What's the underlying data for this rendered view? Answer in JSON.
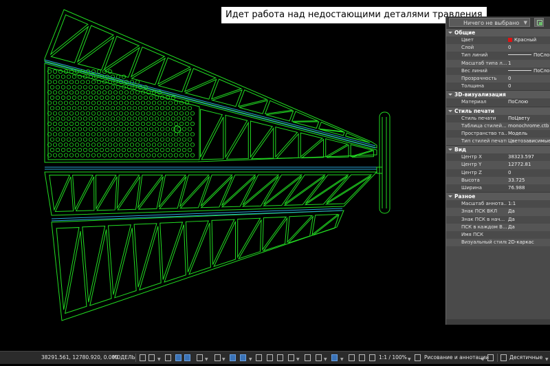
{
  "caption": "Идет работа над недостающими деталями травления",
  "palette": {
    "selection": "Ничего не выбрано",
    "sections": [
      {
        "title": "Общие",
        "rows": [
          {
            "key": "Цвет",
            "value": "Красный",
            "swatch": "#e11111"
          },
          {
            "key": "Слой",
            "value": "0"
          },
          {
            "key": "Тип линий",
            "value": "ПоСлою",
            "line": true
          },
          {
            "key": "Масштаб типа л...",
            "value": "1"
          },
          {
            "key": "Вес линий",
            "value": "ПоСлою",
            "line": true
          },
          {
            "key": "Прозрачность",
            "value": "0"
          },
          {
            "key": "Толщина",
            "value": "0"
          }
        ]
      },
      {
        "title": "3D-визуализация",
        "rows": [
          {
            "key": "Материал",
            "value": "ПоСлою"
          }
        ]
      },
      {
        "title": "Стиль печати",
        "rows": [
          {
            "key": "Стиль печати",
            "value": "ПоЦвету"
          },
          {
            "key": "Таблица стилей...",
            "value": "monochrome.ctb"
          },
          {
            "key": "Пространство та...",
            "value": "Модель"
          },
          {
            "key": "Тип стилей печати",
            "value": "Цветозависимые"
          }
        ]
      },
      {
        "title": "Вид",
        "rows": [
          {
            "key": "Центр X",
            "value": "38323.597"
          },
          {
            "key": "Центр Y",
            "value": "12772.81"
          },
          {
            "key": "Центр Z",
            "value": "0"
          },
          {
            "key": "Высота",
            "value": "33.725"
          },
          {
            "key": "Ширина",
            "value": "76.988"
          }
        ]
      },
      {
        "title": "Разное",
        "rows": [
          {
            "key": "Масштаб аннота...",
            "value": "1:1"
          },
          {
            "key": "Знак ПСК ВКЛ",
            "value": "Да"
          },
          {
            "key": "Знак ПСК в нач...",
            "value": "Да"
          },
          {
            "key": "ПСК в каждом В...",
            "value": "Да"
          },
          {
            "key": "Имя ПСК",
            "value": ""
          },
          {
            "key": "Визуальный стиль",
            "value": "2D-каркас"
          }
        ]
      }
    ]
  },
  "status": {
    "coords": "38291.561, 12780.920, 0.000",
    "model": "МОДЕЛЬ",
    "scale": "1:1 / 100%",
    "workspace": "Рисование и аннотации",
    "units": "Десятичные"
  },
  "colors": {
    "outline": "#22dd22",
    "rail": "#2aa6d8",
    "background": "#000000"
  }
}
